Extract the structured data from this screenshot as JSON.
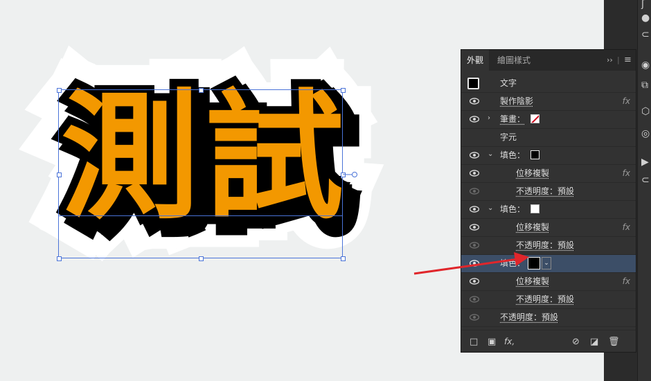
{
  "artwork": {
    "text": "測試"
  },
  "panel": {
    "tabs": [
      {
        "label": "外觀"
      },
      {
        "label": "繪圖樣式"
      }
    ],
    "rows": [
      {
        "label": "文字"
      },
      {
        "label": "製作陰影",
        "fx": "fx"
      },
      {
        "label": "筆畫："
      },
      {
        "label": "字元"
      },
      {
        "label": "填色："
      },
      {
        "label": "位移複製",
        "fx": "fx"
      },
      {
        "label": "不透明度：預設"
      },
      {
        "label": "填色："
      },
      {
        "label": "位移複製",
        "fx": "fx"
      },
      {
        "label": "不透明度：預設"
      },
      {
        "label": "填色："
      },
      {
        "label": "位移複製",
        "fx": "fx"
      },
      {
        "label": "不透明度：預設"
      },
      {
        "label": "不透明度：預設"
      }
    ],
    "footer": {
      "fx_label": "fx,"
    }
  },
  "colors": {
    "accent_fill": "#f39800",
    "selection": "#4a73d8",
    "arrow": "#e0262b",
    "selected_row": "#3c4e67"
  }
}
